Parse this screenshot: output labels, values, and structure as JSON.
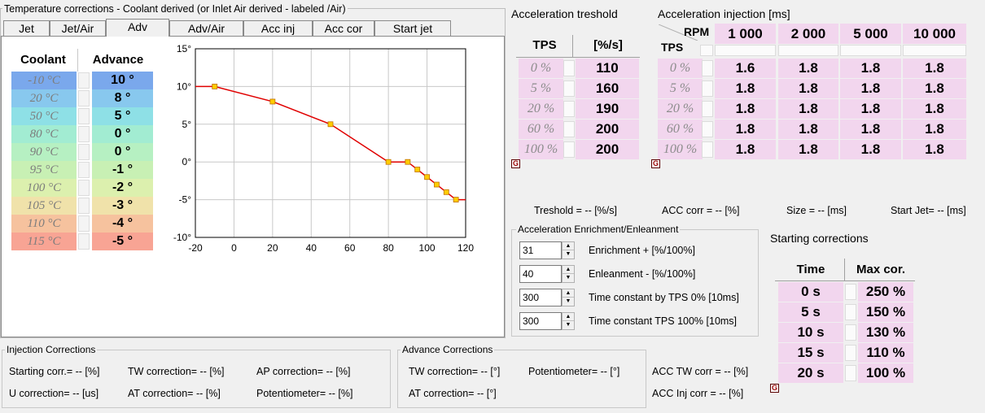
{
  "temp_panel": {
    "title": "Temperature corrections - Coolant derived (or Inlet Air derived - labeled /Air)",
    "tabs": [
      "Jet",
      "Jet/Air",
      "Adv",
      "Adv/Air",
      "Acc inj",
      "Acc cor",
      "Start jet"
    ],
    "active_tab": "Adv",
    "col_coolant": "Coolant",
    "col_advance": "Advance",
    "coolant": [
      "-10 °C",
      "20 °C",
      "50 °C",
      "80 °C",
      "90 °C",
      "95 °C",
      "100 °C",
      "105 °C",
      "110 °C",
      "115 °C"
    ],
    "advance": [
      "10 °",
      "8 °",
      "5 °",
      "0 °",
      "0 °",
      "-1 °",
      "-2 °",
      "-3 °",
      "-4 °",
      "-5 °"
    ],
    "cell_colors": [
      "#7aa8ec",
      "#88c8ee",
      "#8ee0e6",
      "#a2ecd2",
      "#b6f0c2",
      "#c8f0b4",
      "#dcf0ae",
      "#f0e2aa",
      "#f6c29e",
      "#f8a494"
    ]
  },
  "chart_data": {
    "type": "line",
    "x": [
      -10,
      20,
      50,
      80,
      90,
      95,
      100,
      105,
      110,
      115
    ],
    "y": [
      10,
      8,
      5,
      0,
      0,
      -1,
      -2,
      -3,
      -4,
      -5
    ],
    "xlim": [
      -20,
      120
    ],
    "ylim": [
      -10,
      15
    ],
    "xticks": [
      -20,
      0,
      20,
      40,
      60,
      80,
      100,
      120
    ],
    "yticks": [
      15,
      10,
      5,
      0,
      -5,
      -10
    ],
    "xtick_labels": [
      "-20",
      "0",
      "20",
      "40",
      "60",
      "80",
      "100",
      "120"
    ],
    "ytick_labels": [
      "15°",
      "10°",
      "5°",
      "0°",
      "-5°",
      "-10°"
    ],
    "grid": true,
    "line_color": "#e00000",
    "marker_color": "#ffcc00"
  },
  "acc_threshold": {
    "title": "Acceleration treshold",
    "col_tps": "TPS",
    "col_unit": "[%/s]",
    "rows": [
      "0 %",
      "5 %",
      "20 %",
      "60 %",
      "100 %"
    ],
    "values": [
      "110",
      "160",
      "190",
      "200",
      "200"
    ],
    "g_label": "G"
  },
  "acc_injection": {
    "title": "Acceleration injection [ms]",
    "rpm_label": "RPM",
    "tps_label": "TPS",
    "rpms": [
      "1 000",
      "2 000",
      "5 000",
      "10 000"
    ],
    "rows": [
      "0 %",
      "5 %",
      "20 %",
      "60 %",
      "100 %"
    ],
    "values": [
      [
        "1.6",
        "1.8",
        "1.8",
        "1.8"
      ],
      [
        "1.8",
        "1.8",
        "1.8",
        "1.8"
      ],
      [
        "1.8",
        "1.8",
        "1.8",
        "1.8"
      ],
      [
        "1.8",
        "1.8",
        "1.8",
        "1.8"
      ],
      [
        "1.8",
        "1.8",
        "1.8",
        "1.8"
      ]
    ],
    "g_label": "G"
  },
  "status_line": {
    "treshold": "Treshold = -- [%/s]",
    "acc_corr": "ACC corr = -- [%]",
    "size": "Size = -- [ms]",
    "start_jet": "Start Jet= -- [ms]"
  },
  "enrichment": {
    "title": "Acceleration Enrichment/Enleanment",
    "fields": [
      {
        "value": "31",
        "label": "Enrichment + [%/100%]"
      },
      {
        "value": "40",
        "label": "Enleanment - [%/100%]"
      },
      {
        "value": "300",
        "label": "Time constant by TPS 0% [10ms]"
      },
      {
        "value": "300",
        "label": "Time constant TPS 100% [10ms]"
      }
    ]
  },
  "starting": {
    "title": "Starting corrections",
    "col_time": "Time",
    "col_max": "Max cor.",
    "times": [
      "0 s",
      "5 s",
      "10 s",
      "15 s",
      "20 s"
    ],
    "values": [
      "250 %",
      "150 %",
      "130 %",
      "110 %",
      "100 %"
    ],
    "g_label": "G"
  },
  "injection_corr": {
    "title": "Injection Corrections",
    "starting": "Starting corr.= -- [%]",
    "tw": "TW correction= -- [%]",
    "ap": "AP correction= -- [%]",
    "u": "U correction= -- [us]",
    "at": "AT correction= -- [%]",
    "pot": "Potentiometer= -- [%]"
  },
  "advance_corr": {
    "title": "Advance Corrections",
    "tw": "TW correction= -- [°]",
    "pot": "Potentiometer= -- [°]",
    "at": "AT correction= -- [°]"
  },
  "acc_extra": {
    "tw": "ACC TW corr = -- [%]",
    "inj": "ACC Inj corr = -- [%]"
  }
}
